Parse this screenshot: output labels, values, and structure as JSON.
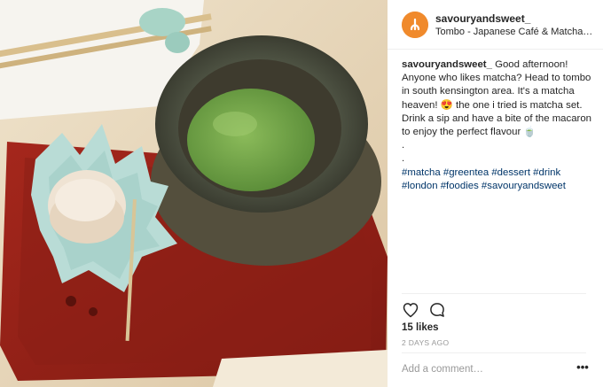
{
  "post": {
    "username": "savouryandsweet_",
    "location": "Tombo - Japanese Café & Matcha…",
    "caption": {
      "username": "savouryandsweet_",
      "text": "Good afternoon! Anyone who likes matcha? Head to tombo in south kensington area. It's a matcha heaven! 😍 the one i tried is matcha set. Drink a sip and have a bite of the macaron to enjoy the perfect flavour 🍵",
      "dot1": ".",
      "dot2": ".",
      "hashtags": "#matcha #greentea #dessert #drink #london #foodies #savouryandsweet"
    },
    "likes": "15 likes",
    "timestamp": "2 DAYS AGO",
    "comment_placeholder": "Add a comment…",
    "more_label": "•••"
  },
  "icons": {
    "like": "heart-outline-icon",
    "comment": "speech-bubble-icon",
    "avatar": "brand-logo-icon"
  },
  "colors": {
    "hashtag": "#003569",
    "text": "#262626",
    "muted": "#999999",
    "avatar": "#f08a2c"
  }
}
